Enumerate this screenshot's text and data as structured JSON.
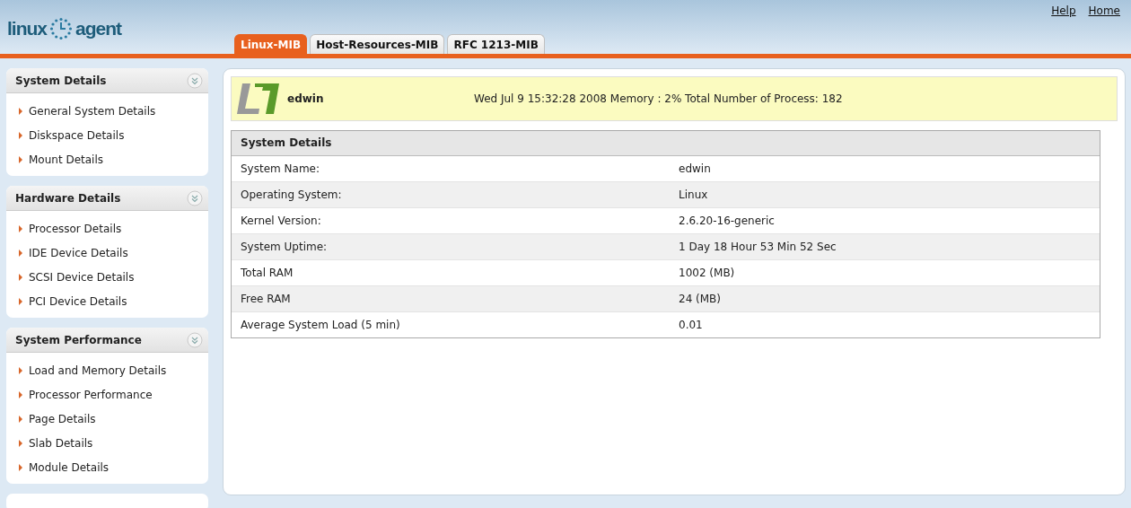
{
  "logo": {
    "left": "linux",
    "right": "agent"
  },
  "top_links": [
    "Help",
    "Home"
  ],
  "tabs": [
    {
      "label": "Linux-MIB",
      "selected": true
    },
    {
      "label": "Host-Resources-MIB",
      "selected": false
    },
    {
      "label": "RFC 1213-MIB",
      "selected": false
    }
  ],
  "sidebar": [
    {
      "title": "System Details",
      "items": [
        "General System Details",
        "Diskspace Details",
        "Mount Details"
      ]
    },
    {
      "title": "Hardware Details",
      "items": [
        "Processor Details",
        "IDE Device Details",
        "SCSI Device Details",
        "PCI Device Details"
      ]
    },
    {
      "title": "System Performance",
      "items": [
        "Load and Memory Details",
        "Processor Performance",
        "Page Details",
        "Slab Details",
        "Module Details"
      ]
    }
  ],
  "banner": {
    "host": "edwin",
    "status": "Wed Jul 9 15:32:28 2008 Memory : 2% Total Number of Process: 182"
  },
  "table": {
    "title": "System Details",
    "rows": [
      {
        "label": "System Name:",
        "value": "edwin"
      },
      {
        "label": "Operating System:",
        "value": "Linux"
      },
      {
        "label": "Kernel Version:",
        "value": "2.6.20-16-generic"
      },
      {
        "label": "System Uptime:",
        "value": "1 Day 18 Hour 53 Min 52 Sec"
      },
      {
        "label": "Total RAM",
        "value": "1002 (MB)"
      },
      {
        "label": "Free RAM",
        "value": "24 (MB)"
      },
      {
        "label": "Average System Load (5 min)",
        "value": "0.01"
      }
    ]
  }
}
